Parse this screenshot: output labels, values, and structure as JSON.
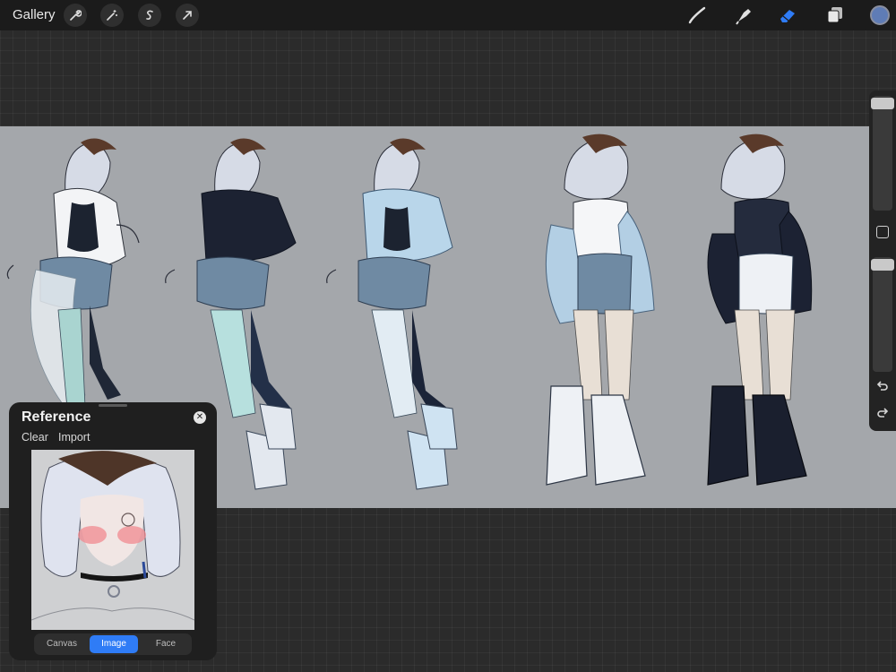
{
  "toolbar": {
    "gallery_label": "Gallery",
    "left_tools": [
      "wrench-icon",
      "magic-wand-icon",
      "selection-icon",
      "transform-arrow-icon"
    ],
    "right_tools": [
      "brush-icon",
      "smudge-icon",
      "eraser-icon",
      "layers-icon"
    ],
    "active_tool": "eraser-icon",
    "accent_color": "#2f7cf6",
    "current_color": "#5f7cb6"
  },
  "sidebar": {
    "brush_size_level": 0.95,
    "opacity_level": 0.95
  },
  "reference_panel": {
    "title": "Reference",
    "clear_label": "Clear",
    "import_label": "Import",
    "tabs": [
      {
        "label": "Canvas",
        "active": false
      },
      {
        "label": "Image",
        "active": true
      },
      {
        "label": "Face",
        "active": false
      }
    ]
  },
  "canvas": {
    "background_color": "#a4a7ab",
    "description_items": 5
  }
}
